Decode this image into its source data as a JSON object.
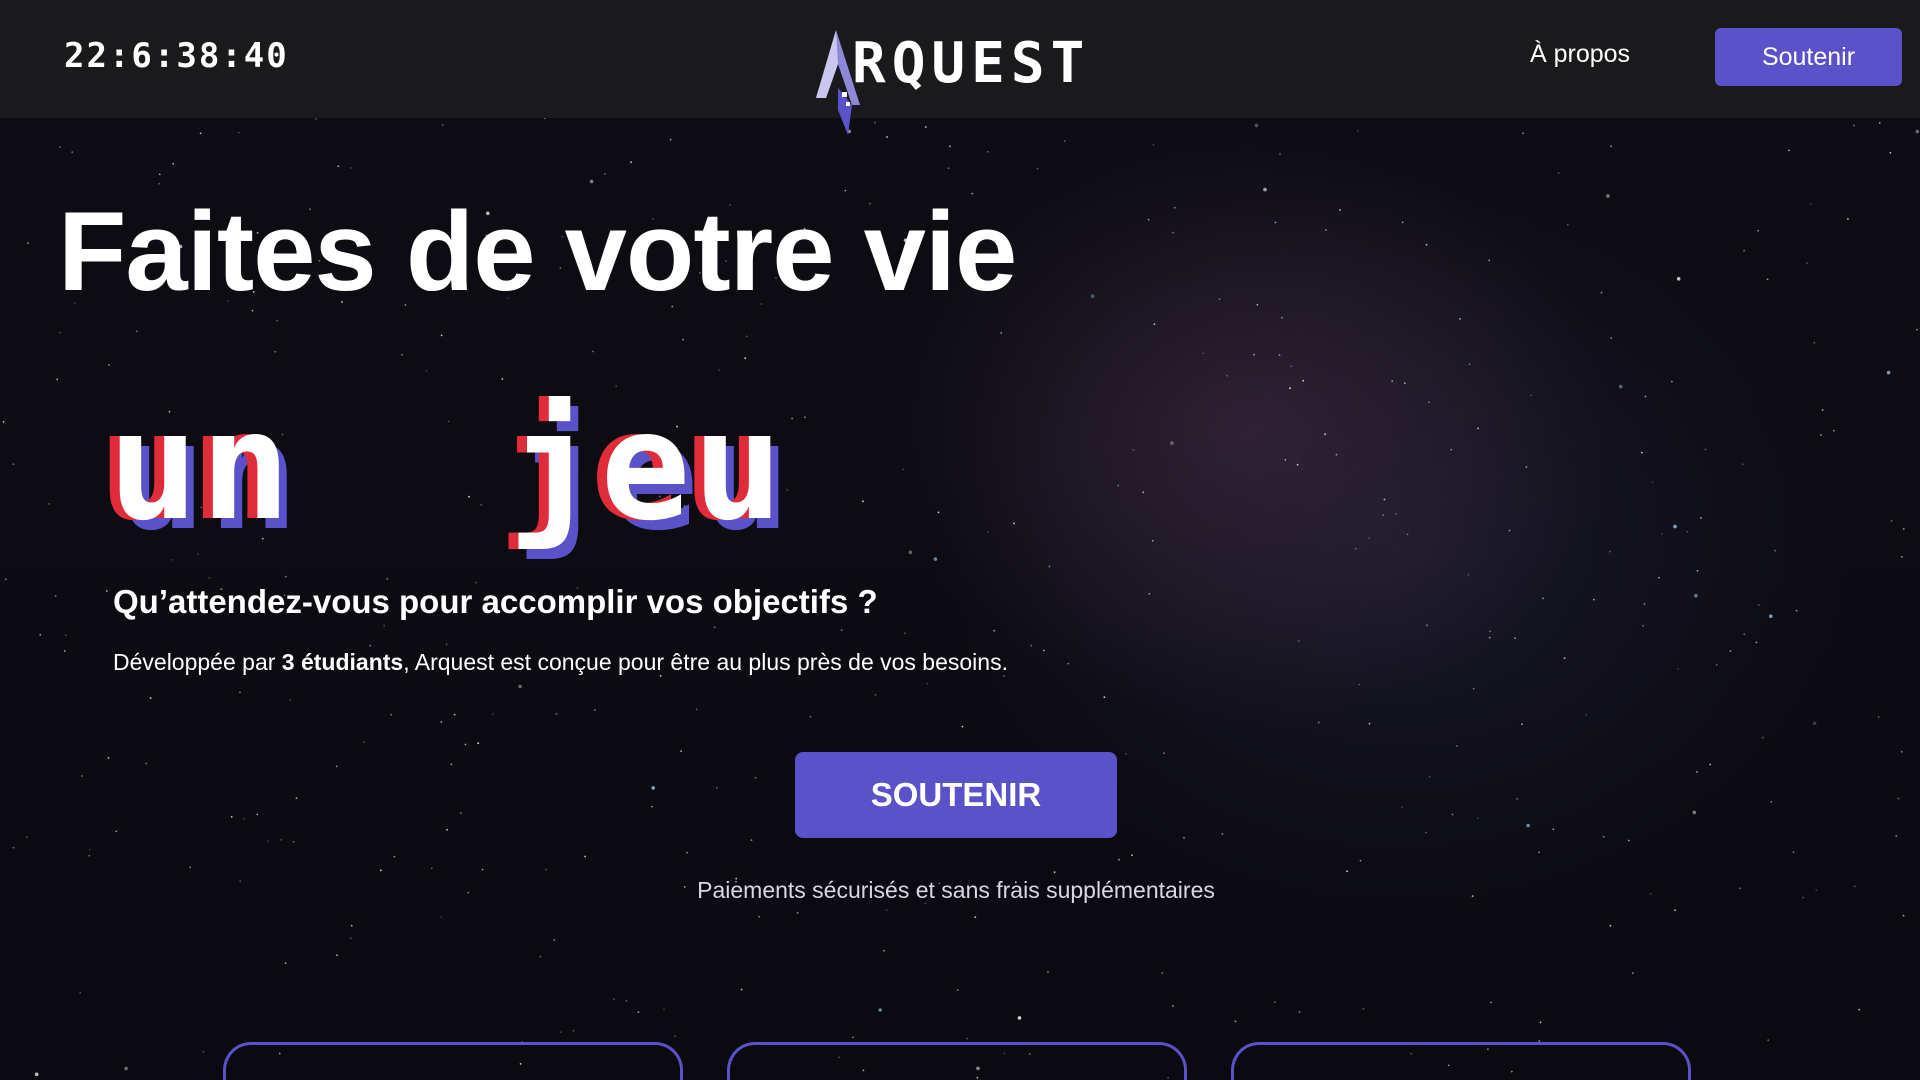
{
  "header": {
    "clock": "22:6:38:40",
    "logo_text": "RQUEST",
    "logo_icon": "arquest-a-logo",
    "nav_about_label": "À propos",
    "nav_support_label": "Soutenir"
  },
  "hero": {
    "title": "Faites de votre vie",
    "pixel_words": [
      "un",
      "jeu"
    ],
    "subheading": "Qu’attendez-vous pour accomplir vos objectifs ?",
    "desc_prefix": "Développée par ",
    "desc_bold": "3 étudiants",
    "desc_suffix": ", Arquest est conçue pour être au plus près de vos besoins.",
    "cta_label": "SOUTENIR",
    "secure_note": "Paiements sécurisés et sans frais supplémentaires"
  },
  "colors": {
    "accent": "#5a52c9",
    "glitch_red": "#e02b3a",
    "header_bg": "#1a191c",
    "page_bg": "#0b0a10"
  }
}
